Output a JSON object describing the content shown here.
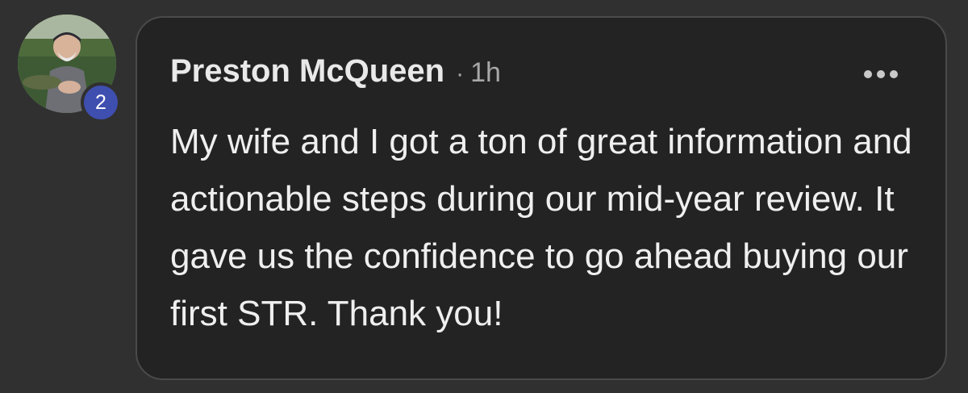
{
  "comment": {
    "author": "Preston McQueen",
    "separator": "·",
    "timestamp": "1h",
    "message": "My wife and I got a ton of great information and actionable steps during our mid-year review. It gave us the confidence to go ahead buying our first STR. Thank you!",
    "badge_count": "2",
    "more_icon": "more-horizontal-icon",
    "avatar": "user-avatar-photo"
  },
  "colors": {
    "page_background": "#303030",
    "bubble_background": "#232323",
    "badge": "#3f4fb0",
    "text_primary": "#efefef",
    "text_secondary": "#a8a8a8"
  }
}
